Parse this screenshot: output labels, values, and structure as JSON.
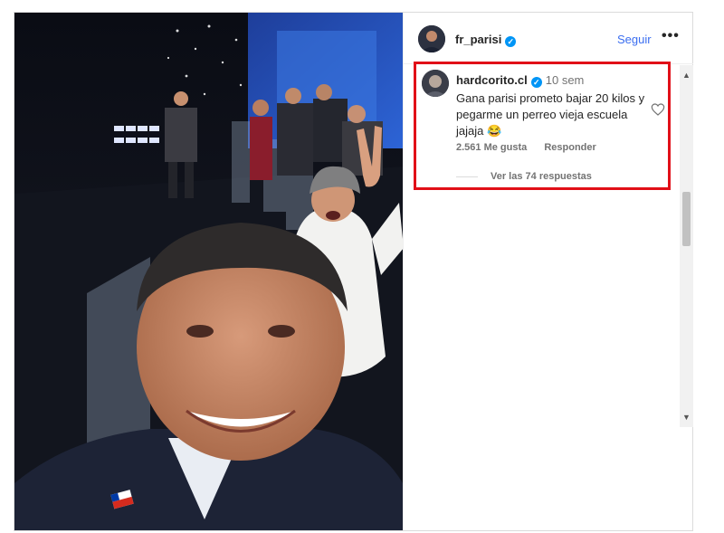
{
  "post": {
    "author": "fr_parisi",
    "follow_label": "Seguir",
    "more_label": "•••",
    "verified_glyph": "✓"
  },
  "comment": {
    "username": "hardcorito.cl",
    "time": "10 sem",
    "text": "Gana parisi prometo bajar 20 kilos y pegarme un perreo vieja escuela jajaja 😂",
    "likes": "2.561 Me gusta",
    "reply_label": "Responder",
    "view_replies": "Ver las 74 respuestas",
    "highlight_color": "#e10f18"
  },
  "scrollbar": {
    "up": "▲",
    "down": "▼"
  },
  "icons": {
    "heart": "heart-icon",
    "verified": "verified-badge-icon",
    "more": "more-options-icon"
  },
  "colors": {
    "link": "#3b6ef0",
    "verified": "#0095f6"
  }
}
